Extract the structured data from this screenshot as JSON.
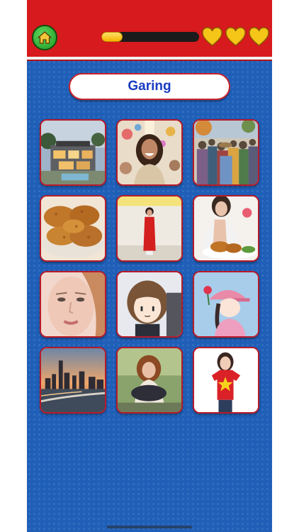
{
  "header": {
    "progress_fraction": 0.22,
    "lives": 3,
    "colors": {
      "bar": "#d61a1d",
      "heart": "#f5c518"
    }
  },
  "title": {
    "text": "Garing"
  },
  "tiles": [
    {
      "subject": "modern-house"
    },
    {
      "subject": "laughing-woman"
    },
    {
      "subject": "crowd-street"
    },
    {
      "subject": "fried-chicken"
    },
    {
      "subject": "woman-red-ao-dai"
    },
    {
      "subject": "refusing-fried-chicken"
    },
    {
      "subject": "woman-face-closeup"
    },
    {
      "subject": "anime-girl"
    },
    {
      "subject": "cartoon-girl-pink-cap"
    },
    {
      "subject": "city-skyline-sunset"
    },
    {
      "subject": "sad-woman-sitting"
    },
    {
      "subject": "woman-red-shirt-star"
    }
  ]
}
